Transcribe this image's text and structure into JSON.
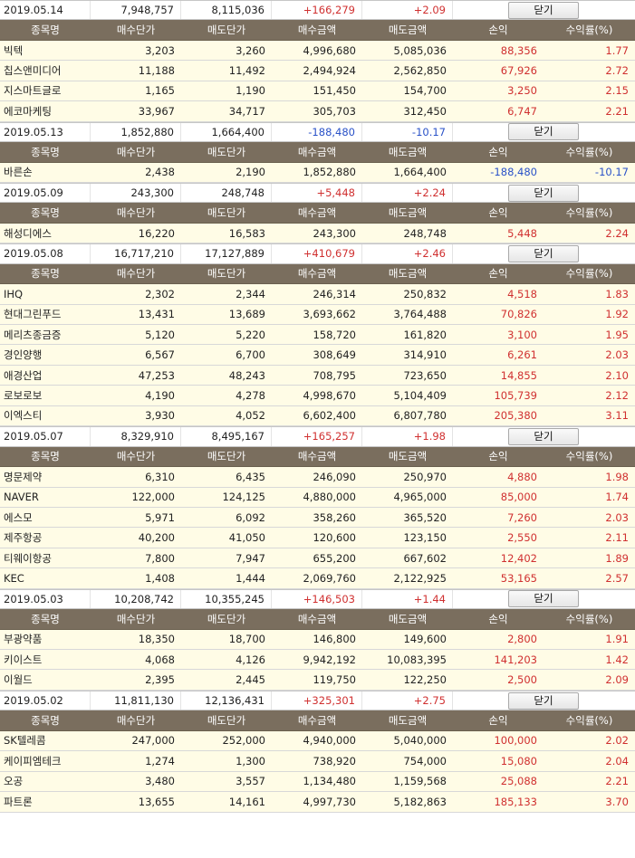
{
  "headers": [
    "종목명",
    "매수단가",
    "매도단가",
    "매수금액",
    "매도금액",
    "손익",
    "수익률(%)"
  ],
  "close_label": "닫기",
  "days": [
    {
      "date": "2019.05.14",
      "buy_total": "7,948,757",
      "sell_total": "8,115,036",
      "pnl": "+166,279",
      "rate": "+2.09",
      "sign": "pos",
      "items": [
        {
          "name": "빅텍",
          "buy_price": "3,203",
          "sell_price": "3,260",
          "buy_amt": "4,996,680",
          "sell_amt": "5,085,036",
          "pnl": "88,356",
          "rate": "1.77",
          "sign": "pos"
        },
        {
          "name": "칩스앤미디어",
          "buy_price": "11,188",
          "sell_price": "11,492",
          "buy_amt": "2,494,924",
          "sell_amt": "2,562,850",
          "pnl": "67,926",
          "rate": "2.72",
          "sign": "pos"
        },
        {
          "name": "지스마트글로",
          "buy_price": "1,165",
          "sell_price": "1,190",
          "buy_amt": "151,450",
          "sell_amt": "154,700",
          "pnl": "3,250",
          "rate": "2.15",
          "sign": "pos"
        },
        {
          "name": "에코마케팅",
          "buy_price": "33,967",
          "sell_price": "34,717",
          "buy_amt": "305,703",
          "sell_amt": "312,450",
          "pnl": "6,747",
          "rate": "2.21",
          "sign": "pos"
        }
      ]
    },
    {
      "date": "2019.05.13",
      "buy_total": "1,852,880",
      "sell_total": "1,664,400",
      "pnl": "-188,480",
      "rate": "-10.17",
      "sign": "neg",
      "items": [
        {
          "name": "바른손",
          "buy_price": "2,438",
          "sell_price": "2,190",
          "buy_amt": "1,852,880",
          "sell_amt": "1,664,400",
          "pnl": "-188,480",
          "rate": "-10.17",
          "sign": "neg"
        }
      ]
    },
    {
      "date": "2019.05.09",
      "buy_total": "243,300",
      "sell_total": "248,748",
      "pnl": "+5,448",
      "rate": "+2.24",
      "sign": "pos",
      "items": [
        {
          "name": "해성디에스",
          "buy_price": "16,220",
          "sell_price": "16,583",
          "buy_amt": "243,300",
          "sell_amt": "248,748",
          "pnl": "5,448",
          "rate": "2.24",
          "sign": "pos"
        }
      ]
    },
    {
      "date": "2019.05.08",
      "buy_total": "16,717,210",
      "sell_total": "17,127,889",
      "pnl": "+410,679",
      "rate": "+2.46",
      "sign": "pos",
      "items": [
        {
          "name": "IHQ",
          "buy_price": "2,302",
          "sell_price": "2,344",
          "buy_amt": "246,314",
          "sell_amt": "250,832",
          "pnl": "4,518",
          "rate": "1.83",
          "sign": "pos"
        },
        {
          "name": "현대그린푸드",
          "buy_price": "13,431",
          "sell_price": "13,689",
          "buy_amt": "3,693,662",
          "sell_amt": "3,764,488",
          "pnl": "70,826",
          "rate": "1.92",
          "sign": "pos"
        },
        {
          "name": "메리츠종금증",
          "buy_price": "5,120",
          "sell_price": "5,220",
          "buy_amt": "158,720",
          "sell_amt": "161,820",
          "pnl": "3,100",
          "rate": "1.95",
          "sign": "pos"
        },
        {
          "name": "경인양행",
          "buy_price": "6,567",
          "sell_price": "6,700",
          "buy_amt": "308,649",
          "sell_amt": "314,910",
          "pnl": "6,261",
          "rate": "2.03",
          "sign": "pos"
        },
        {
          "name": "애경산업",
          "buy_price": "47,253",
          "sell_price": "48,243",
          "buy_amt": "708,795",
          "sell_amt": "723,650",
          "pnl": "14,855",
          "rate": "2.10",
          "sign": "pos"
        },
        {
          "name": "로보로보",
          "buy_price": "4,190",
          "sell_price": "4,278",
          "buy_amt": "4,998,670",
          "sell_amt": "5,104,409",
          "pnl": "105,739",
          "rate": "2.12",
          "sign": "pos"
        },
        {
          "name": "이엑스티",
          "buy_price": "3,930",
          "sell_price": "4,052",
          "buy_amt": "6,602,400",
          "sell_amt": "6,807,780",
          "pnl": "205,380",
          "rate": "3.11",
          "sign": "pos"
        }
      ]
    },
    {
      "date": "2019.05.07",
      "buy_total": "8,329,910",
      "sell_total": "8,495,167",
      "pnl": "+165,257",
      "rate": "+1.98",
      "sign": "pos",
      "items": [
        {
          "name": "명문제약",
          "buy_price": "6,310",
          "sell_price": "6,435",
          "buy_amt": "246,090",
          "sell_amt": "250,970",
          "pnl": "4,880",
          "rate": "1.98",
          "sign": "pos"
        },
        {
          "name": "NAVER",
          "buy_price": "122,000",
          "sell_price": "124,125",
          "buy_amt": "4,880,000",
          "sell_amt": "4,965,000",
          "pnl": "85,000",
          "rate": "1.74",
          "sign": "pos"
        },
        {
          "name": "에스모",
          "buy_price": "5,971",
          "sell_price": "6,092",
          "buy_amt": "358,260",
          "sell_amt": "365,520",
          "pnl": "7,260",
          "rate": "2.03",
          "sign": "pos"
        },
        {
          "name": "제주항공",
          "buy_price": "40,200",
          "sell_price": "41,050",
          "buy_amt": "120,600",
          "sell_amt": "123,150",
          "pnl": "2,550",
          "rate": "2.11",
          "sign": "pos"
        },
        {
          "name": "티웨이항공",
          "buy_price": "7,800",
          "sell_price": "7,947",
          "buy_amt": "655,200",
          "sell_amt": "667,602",
          "pnl": "12,402",
          "rate": "1.89",
          "sign": "pos"
        },
        {
          "name": "KEC",
          "buy_price": "1,408",
          "sell_price": "1,444",
          "buy_amt": "2,069,760",
          "sell_amt": "2,122,925",
          "pnl": "53,165",
          "rate": "2.57",
          "sign": "pos"
        }
      ]
    },
    {
      "date": "2019.05.03",
      "buy_total": "10,208,742",
      "sell_total": "10,355,245",
      "pnl": "+146,503",
      "rate": "+1.44",
      "sign": "pos",
      "items": [
        {
          "name": "부광약품",
          "buy_price": "18,350",
          "sell_price": "18,700",
          "buy_amt": "146,800",
          "sell_amt": "149,600",
          "pnl": "2,800",
          "rate": "1.91",
          "sign": "pos"
        },
        {
          "name": "키이스트",
          "buy_price": "4,068",
          "sell_price": "4,126",
          "buy_amt": "9,942,192",
          "sell_amt": "10,083,395",
          "pnl": "141,203",
          "rate": "1.42",
          "sign": "pos"
        },
        {
          "name": "이월드",
          "buy_price": "2,395",
          "sell_price": "2,445",
          "buy_amt": "119,750",
          "sell_amt": "122,250",
          "pnl": "2,500",
          "rate": "2.09",
          "sign": "pos"
        }
      ]
    },
    {
      "date": "2019.05.02",
      "buy_total": "11,811,130",
      "sell_total": "12,136,431",
      "pnl": "+325,301",
      "rate": "+2.75",
      "sign": "pos",
      "items": [
        {
          "name": "SK텔레콤",
          "buy_price": "247,000",
          "sell_price": "252,000",
          "buy_amt": "4,940,000",
          "sell_amt": "5,040,000",
          "pnl": "100,000",
          "rate": "2.02",
          "sign": "pos"
        },
        {
          "name": "케이피엠테크",
          "buy_price": "1,274",
          "sell_price": "1,300",
          "buy_amt": "738,920",
          "sell_amt": "754,000",
          "pnl": "15,080",
          "rate": "2.04",
          "sign": "pos"
        },
        {
          "name": "오공",
          "buy_price": "3,480",
          "sell_price": "3,557",
          "buy_amt": "1,134,480",
          "sell_amt": "1,159,568",
          "pnl": "25,088",
          "rate": "2.21",
          "sign": "pos"
        },
        {
          "name": "파트론",
          "buy_price": "13,655",
          "sell_price": "14,161",
          "buy_amt": "4,997,730",
          "sell_amt": "5,182,863",
          "pnl": "185,133",
          "rate": "3.70",
          "sign": "pos"
        }
      ]
    }
  ]
}
